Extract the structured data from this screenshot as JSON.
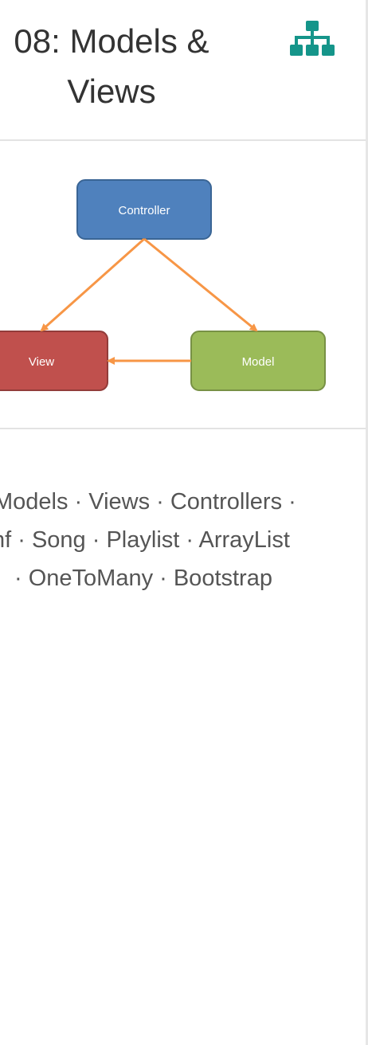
{
  "header": {
    "title_line1": "08: Models &",
    "title_line2": "Views",
    "icon": "sitemap-icon"
  },
  "diagram": {
    "nodes": {
      "controller": {
        "label": "Controller",
        "color": "#4f81bd"
      },
      "view": {
        "label": "View",
        "color": "#c0504d"
      },
      "model": {
        "label": "Model",
        "color": "#9bbb59"
      }
    },
    "arrow_color": "#f79646"
  },
  "tags": {
    "line1": "Models · Views · Controllers ·",
    "line2": "nf · Song · Playlist · ArrayList",
    "line3": "· OneToMany · Bootstrap"
  },
  "colors": {
    "accent": "#15958a",
    "border": "#e3e3e3",
    "text": "#333333"
  }
}
